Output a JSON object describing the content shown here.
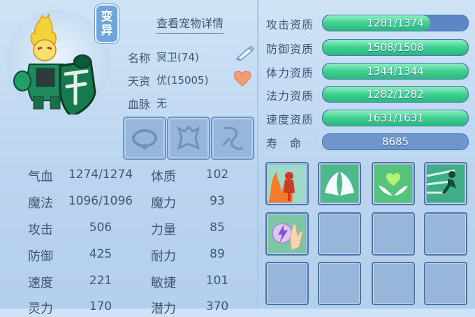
{
  "pet": {
    "detail_link": "查看宠物详情",
    "mutation_badge": [
      "变",
      "异"
    ],
    "name_label": "名称",
    "name_value": "冥卫(74)",
    "talent_label": "天资",
    "talent_value": "优(15005)",
    "bloodline_label": "血脉",
    "bloodline_value": "无"
  },
  "stats": {
    "left": [
      {
        "label": "气血",
        "value": "1274/1274"
      },
      {
        "label": "魔法",
        "value": "1096/1096"
      },
      {
        "label": "攻击",
        "value": "506"
      },
      {
        "label": "防御",
        "value": "425"
      },
      {
        "label": "速度",
        "value": "221"
      },
      {
        "label": "灵力",
        "value": "170"
      }
    ],
    "right": [
      {
        "label": "体质",
        "value": "102"
      },
      {
        "label": "魔力",
        "value": "93"
      },
      {
        "label": "力量",
        "value": "85"
      },
      {
        "label": "耐力",
        "value": "89"
      },
      {
        "label": "敏捷",
        "value": "101"
      },
      {
        "label": "潜力",
        "value": "370"
      }
    ]
  },
  "aptitudes": [
    {
      "label": "攻击资质",
      "value": "1281/1374",
      "fill": 0.74
    },
    {
      "label": "防御资质",
      "value": "1508/1508",
      "fill": 1.0
    },
    {
      "label": "体力资质",
      "value": "1344/1344",
      "fill": 1.0
    },
    {
      "label": "法力资质",
      "value": "1282/1282",
      "fill": 1.0
    },
    {
      "label": "速度资质",
      "value": "1631/1631",
      "fill": 1.0
    },
    {
      "label": "寿　命",
      "value": "8685"
    }
  ],
  "equipment_slots": [
    "collar-icon",
    "armor-icon",
    "charm-icon"
  ],
  "skills": [
    "fire-aura-skill-icon",
    "wings-skill-icon",
    "heart-wings-skill-icon",
    "sprint-skill-icon",
    "lightning-hand-skill-icon"
  ],
  "colors": {
    "bar_fill": "#3fcf91",
    "bar_bg": "#5c86c6",
    "text": "#3f5670"
  }
}
